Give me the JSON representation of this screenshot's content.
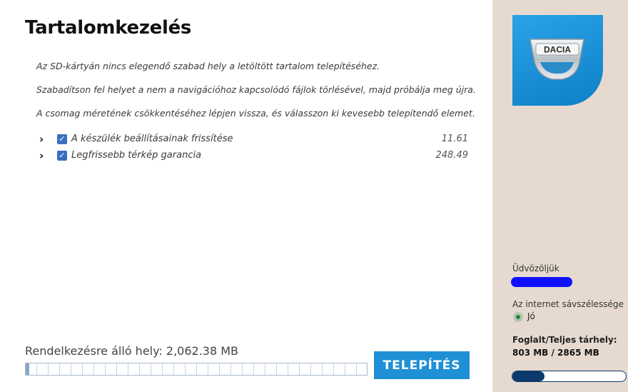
{
  "title": "Tartalomkezelés",
  "messages": [
    "Az SD-kártyán nincs elegendő szabad hely a letöltött tartalom telepítéséhez.",
    "Szabadítson fel helyet a nem a navigációhoz kapcsolódó fájlok törlésével, majd próbálja meg újra.",
    "A csomag méretének csökkentéséhez lépjen vissza, és válasszon ki kevesebb telepítendő elemet."
  ],
  "items": [
    {
      "label": "A készülék beállításainak frissítése",
      "size": "11.61",
      "checked": true,
      "expand_glyph": "›"
    },
    {
      "label": "Legfrissebb térkép garancia",
      "size": "248.49",
      "checked": true,
      "expand_glyph": "›"
    }
  ],
  "checkbox_glyph": "✓",
  "available_space": "Rendelkezésre álló hely: 2,062.38 MB",
  "install_progress_fraction": 0.01,
  "install_button": "TELEPÍTÉS",
  "logo": {
    "brand_text": "DACIA"
  },
  "sidebar": {
    "welcome": "Üdvözöljük",
    "bandwidth_label": "Az internet sávszélessége",
    "bandwidth_value": "Jó",
    "storage_label": "Foglalt/Teljes tárhely:",
    "storage_value": "803 MB / 2865 MB",
    "storage_fraction": 0.28
  },
  "colors": {
    "accent": "#1f90d5",
    "sidebar_bg": "#e6dad0",
    "checkbox": "#3a6fbf",
    "status_good": "#1f8a2c",
    "storage_bar": "#0e3a6b"
  }
}
